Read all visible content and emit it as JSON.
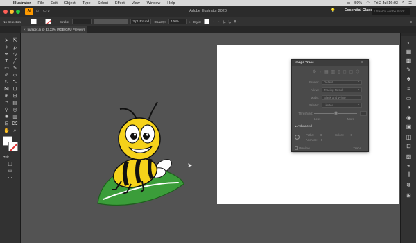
{
  "menubar": {
    "app": "Illustrator",
    "items": [
      "File",
      "Edit",
      "Object",
      "Type",
      "Select",
      "Effect",
      "View",
      "Window",
      "Help"
    ],
    "status": {
      "battery": "59%",
      "clock": "Fri 2 Jul 16:03"
    }
  },
  "titlebar": {
    "title": "Adobe Illustrator 2020",
    "workspace": "Essential Classic",
    "search_placeholder": "Search Adobe Stock"
  },
  "controlbar": {
    "selection": "No Selection",
    "stroke_label": "Stroke:",
    "brush_value": "3 pt. Round",
    "opacity_label": "Opacity:",
    "opacity_value": "100%",
    "style_label": "Style:"
  },
  "document_tab": {
    "label": "bumper.ai @ 33.33% (RGB/GPU Preview)"
  },
  "image_trace": {
    "title": "Image Trace",
    "rows": [
      {
        "key": "Preset:",
        "value": "Default"
      },
      {
        "key": "View:",
        "value": "Tracing Result"
      },
      {
        "key": "Mode:",
        "value": "Black and White"
      },
      {
        "key": "Palette:",
        "value": "Limited"
      }
    ],
    "threshold_label": "Threshold:",
    "threshold_fraction": 0.5,
    "less_label": "Less",
    "more_label": "More",
    "advanced_label": "Advanced",
    "paths_label": "Paths:",
    "paths_value": "0",
    "colors_label": "Colors:",
    "colors_value": "0",
    "anchors_label": "Anchors:",
    "anchors_value": "0",
    "preview_label": "Preview",
    "trace_button": "Trace"
  },
  "colors": {
    "traffic_close": "#ff5f57",
    "traffic_min": "#febc2e",
    "traffic_max": "#28c840",
    "leaf": "#3b9d3a",
    "bee_yellow": "#f6d21a"
  }
}
